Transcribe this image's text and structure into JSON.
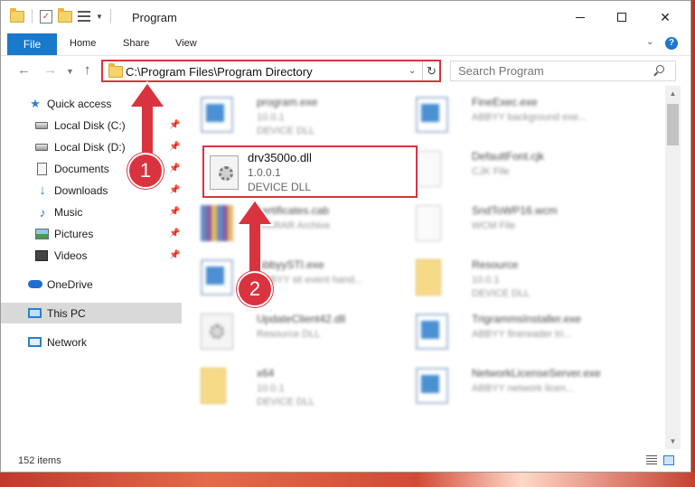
{
  "window": {
    "title": "Program"
  },
  "ribbon": {
    "tabs": [
      {
        "label": "File"
      },
      {
        "label": "Home"
      },
      {
        "label": "Share"
      },
      {
        "label": "View"
      }
    ]
  },
  "navbar": {
    "address": "C:\\Program Files\\Program Directory",
    "search_placeholder": "Search Program"
  },
  "sidebar": {
    "items": [
      {
        "label": "Quick access",
        "icon": "star-icon",
        "pinned": false
      },
      {
        "label": "Local Disk (C:)",
        "icon": "drive-icon",
        "pinned": true
      },
      {
        "label": "Local Disk (D:)",
        "icon": "drive-icon",
        "pinned": true
      },
      {
        "label": "Documents",
        "icon": "documents-icon",
        "pinned": true
      },
      {
        "label": "Downloads",
        "icon": "download-icon",
        "pinned": true
      },
      {
        "label": "Music",
        "icon": "music-icon",
        "pinned": true
      },
      {
        "label": "Pictures",
        "icon": "pictures-icon",
        "pinned": true
      },
      {
        "label": "Videos",
        "icon": "videos-icon",
        "pinned": true
      },
      {
        "label": "OneDrive",
        "icon": "onedrive-icon",
        "pinned": false
      },
      {
        "label": "This PC",
        "icon": "pc-icon",
        "pinned": false,
        "selected": true
      },
      {
        "label": "Network",
        "icon": "network-icon",
        "pinned": false
      }
    ]
  },
  "files": {
    "left": [
      {
        "name": "program.exe",
        "line1": "10.0.1",
        "line2": "DEVICE DLL",
        "icon": "exe-icon"
      },
      {
        "name": "drv3500o.dll",
        "line1": "1.0.0.1",
        "line2": "DEVICE DLL",
        "icon": "dll-icon",
        "highlighted": true
      },
      {
        "name": "certificates.cab",
        "line1": "WinRAR Archive",
        "line2": "",
        "icon": "archive-icon"
      },
      {
        "name": "AbbyySTI.exe",
        "line1": "ABBYY sti event hand...",
        "line2": "",
        "icon": "exe-icon"
      },
      {
        "name": "UpdateClient42.dll",
        "line1": "Resource DLL",
        "line2": "",
        "icon": "dll-icon"
      },
      {
        "name": "x64",
        "line1": "10.0.1",
        "line2": "DEVICE DLL",
        "icon": "folder-icon"
      }
    ],
    "right": [
      {
        "name": "FineExec.exe",
        "line1": "ABBYY background exe...",
        "line2": "",
        "icon": "exe-icon"
      },
      {
        "name": "DefaultFont.cjk",
        "line1": "CJK File",
        "line2": "",
        "icon": "file-icon"
      },
      {
        "name": "SndToWP16.wcm",
        "line1": "WCM File",
        "line2": "",
        "icon": "file-icon"
      },
      {
        "name": "Resource",
        "line1": "10.0.1",
        "line2": "DEVICE DLL",
        "icon": "folder-icon"
      },
      {
        "name": "TrigrammsInstaller.exe",
        "line1": "ABBYY finereader tri...",
        "line2": "",
        "icon": "exe-icon"
      },
      {
        "name": "NetworkLicenseServer.exe",
        "line1": "ABBYY network licen...",
        "line2": "",
        "icon": "exe-icon"
      }
    ]
  },
  "status": {
    "item_count": "152 items"
  },
  "annotations": {
    "marker1": "1",
    "marker2": "2"
  },
  "colors": {
    "accent": "#1979ca",
    "annotation_red": "#d9333f",
    "selection": "#d9d9d9"
  }
}
